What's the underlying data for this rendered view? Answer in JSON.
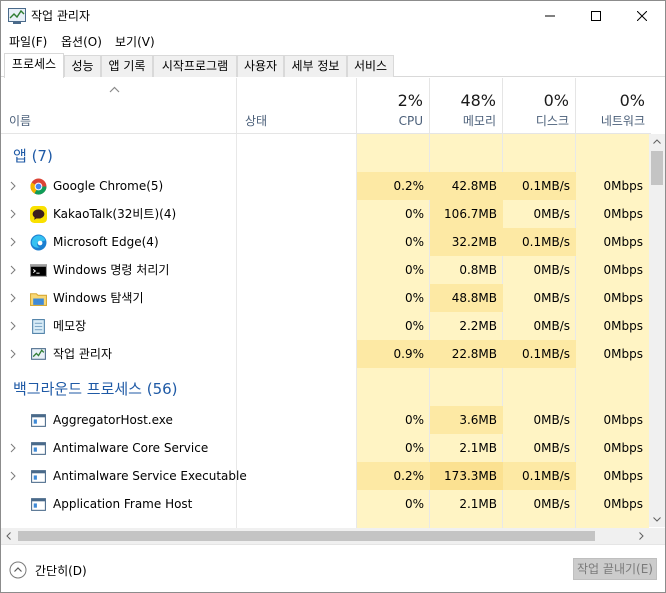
{
  "window": {
    "title": "작업 관리자"
  },
  "menu": [
    "파일(F)",
    "옵션(O)",
    "보기(V)"
  ],
  "tabs": [
    "프로세스",
    "성능",
    "앱 기록",
    "시작프로그램",
    "사용자",
    "세부 정보",
    "서비스"
  ],
  "columns": {
    "name": "이름",
    "status": "상태",
    "cpu": {
      "pct": "2%",
      "label": "CPU"
    },
    "memory": {
      "pct": "48%",
      "label": "메모리"
    },
    "disk": {
      "pct": "0%",
      "label": "디스크"
    },
    "network": {
      "pct": "0%",
      "label": "네트워크"
    }
  },
  "groups": {
    "apps": "앱 (7)",
    "background": "백그라운드 프로세스 (56)"
  },
  "apps": [
    {
      "name": "Google Chrome(5)",
      "icon": "chrome-icon",
      "cpu": "0.2%",
      "mem": "42.8MB",
      "disk": "0.1MB/s",
      "net": "0Mbps"
    },
    {
      "name": "KakaoTalk(32비트)(4)",
      "icon": "kakaotalk-icon",
      "cpu": "0%",
      "mem": "106.7MB",
      "disk": "0MB/s",
      "net": "0Mbps"
    },
    {
      "name": "Microsoft Edge(4)",
      "icon": "edge-icon",
      "cpu": "0%",
      "mem": "32.2MB",
      "disk": "0.1MB/s",
      "net": "0Mbps"
    },
    {
      "name": "Windows 명령 처리기",
      "icon": "cmd-icon",
      "cpu": "0%",
      "mem": "0.8MB",
      "disk": "0MB/s",
      "net": "0Mbps"
    },
    {
      "name": "Windows 탐색기",
      "icon": "explorer-icon",
      "cpu": "0%",
      "mem": "48.8MB",
      "disk": "0MB/s",
      "net": "0Mbps"
    },
    {
      "name": "메모장",
      "icon": "notepad-icon",
      "cpu": "0%",
      "mem": "2.2MB",
      "disk": "0MB/s",
      "net": "0Mbps"
    },
    {
      "name": "작업 관리자",
      "icon": "task-manager-icon",
      "cpu": "0.9%",
      "mem": "22.8MB",
      "disk": "0.1MB/s",
      "net": "0Mbps"
    }
  ],
  "background": [
    {
      "name": "AggregatorHost.exe",
      "icon": "service-icon",
      "cpu": "0%",
      "mem": "3.6MB",
      "disk": "0MB/s",
      "net": "0Mbps"
    },
    {
      "name": "Antimalware Core Service",
      "icon": "service-icon",
      "cpu": "0%",
      "mem": "2.1MB",
      "disk": "0MB/s",
      "net": "0Mbps"
    },
    {
      "name": "Antimalware Service Executable",
      "icon": "service-icon",
      "cpu": "0.2%",
      "mem": "173.3MB",
      "disk": "0.1MB/s",
      "net": "0Mbps"
    },
    {
      "name": "Application Frame Host",
      "icon": "service-icon",
      "cpu": "0%",
      "mem": "2.1MB",
      "disk": "0MB/s",
      "net": "0Mbps"
    }
  ],
  "footer": {
    "fewer_details": "간단히(D)",
    "end_task": "작업 끝내기(E)"
  }
}
